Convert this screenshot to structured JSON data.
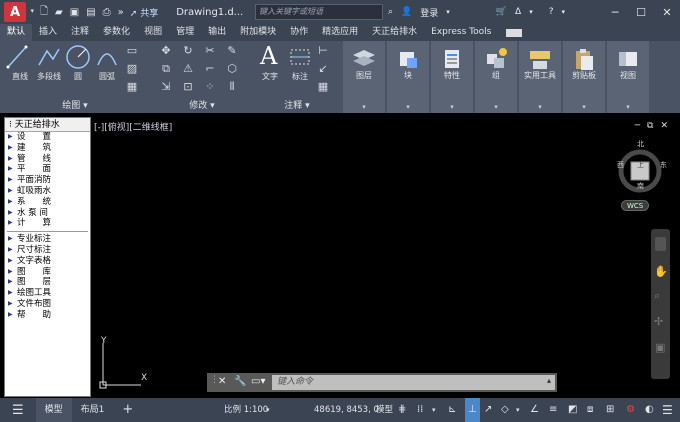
{
  "titlebar": {
    "logo_letter": "A",
    "share_label": "共享",
    "doc_title": "Drawing1.d...",
    "search_placeholder": "键入关键字或短语",
    "login_label": "登录"
  },
  "tabs": [
    "默认",
    "插入",
    "注释",
    "参数化",
    "视图",
    "管理",
    "输出",
    "附加模块",
    "协作",
    "精选应用",
    "天正给排水",
    "Express Tools"
  ],
  "active_tab": "默认",
  "ribbon": {
    "draw": {
      "line": "直线",
      "polyline": "多段线",
      "circle": "圆",
      "arc": "圆弧",
      "panel": "绘图"
    },
    "modify": {
      "panel": "修改"
    },
    "annotation": {
      "text": "文字",
      "dimension": "标注",
      "panel": "注释"
    },
    "big": [
      {
        "key": "layers",
        "label": "图层"
      },
      {
        "key": "block",
        "label": "块"
      },
      {
        "key": "properties",
        "label": "特性"
      },
      {
        "key": "group",
        "label": "组"
      },
      {
        "key": "utilities",
        "label": "实用工具"
      },
      {
        "key": "clipboard",
        "label": "剪贴板"
      },
      {
        "key": "view",
        "label": "视图"
      }
    ]
  },
  "palette": {
    "title": "天正给排水",
    "group1": [
      "设　　置",
      "建　　筑",
      "管　　线",
      "平　　面",
      "平面消防",
      "虹吸雨水",
      "系　　统",
      "水 泵 间",
      "计　　算"
    ],
    "group2": [
      "专业标注",
      "尺寸标注",
      "文字表格",
      "图　　库",
      "图　　层",
      "绘图工具",
      "文件布图",
      "帮　　助"
    ]
  },
  "viewport": {
    "label": "[-][俯视][二维线框]",
    "compass": {
      "north": "北",
      "south": "南",
      "east": "东",
      "west": "西",
      "top": "上"
    },
    "wcs": "WCS",
    "ucs_y": "Y",
    "ucs_x": "X"
  },
  "command": {
    "placeholder": "键入命令"
  },
  "status": {
    "model_tab": "模型",
    "layout1": "布局1",
    "add": "+",
    "scale": "比例 1:100",
    "coords": "48619, 8453, 0",
    "space": "模型"
  },
  "colors": {
    "accent": "#d1343a",
    "ribbon_bg": "#4a5363",
    "title_bg": "#3b4453"
  }
}
